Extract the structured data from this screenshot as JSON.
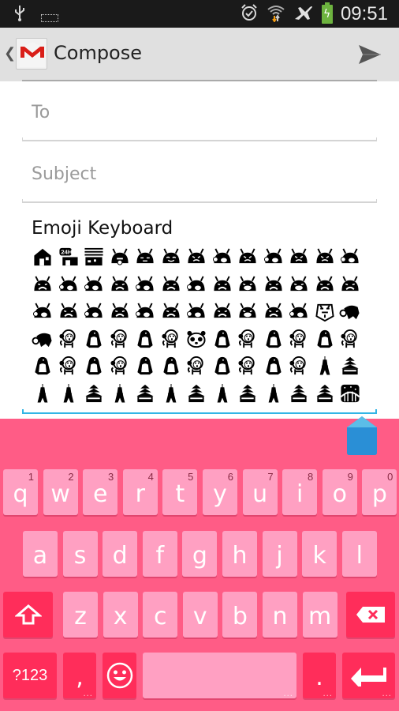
{
  "status_bar": {
    "left_icons": [
      "usb-icon",
      "keyboard-icon"
    ],
    "right_icons": [
      "alarm-icon",
      "wifi-icon",
      "airplane-icon",
      "battery-charging-icon"
    ],
    "time": "09:51",
    "battery_color": "#6db33f"
  },
  "action_bar": {
    "back_icon": "chevron-left-icon",
    "app_icon": "gmail-icon",
    "title": "Compose",
    "send_icon": "send-icon"
  },
  "compose": {
    "to_placeholder": "To",
    "to_value": "",
    "subject_placeholder": "Subject",
    "subject_value": "",
    "body_text": "Emoji Keyboard",
    "focus_color": "#33b5e5",
    "emoji_rows": [
      [
        "house",
        "convenience-store-24h",
        "office-building",
        "droid-tongue",
        "droid-sleepy",
        "droid-content",
        "droid-angry",
        "droid-sweat",
        "droid-angry",
        "droid-sweat",
        "droid-angry",
        "droid-angry",
        "droid-sweat"
      ],
      [
        "droid-sad",
        "droid-sweat",
        "droid-sweat",
        "droid-sad",
        "droid-sweat",
        "droid-sad",
        "droid-sweat",
        "droid-sad",
        "droid-crying",
        "droid-sad",
        "droid-crying",
        "droid-sad",
        "droid-sad"
      ],
      [
        "droid-sweat",
        "droid-sad",
        "droid-sweat",
        "droid-sad",
        "droid-sweat",
        "droid-sad",
        "droid-sweat",
        "droid-sad",
        "droid-crying",
        "droid-sad",
        "droid-sweat",
        "tiger-face",
        "boar"
      ],
      [
        "boar",
        "monkey",
        "penguin",
        "monkey",
        "penguin",
        "monkey",
        "panda-face",
        "penguin",
        "monkey",
        "penguin",
        "monkey",
        "penguin",
        "monkey"
      ],
      [
        "penguin",
        "monkey",
        "penguin",
        "monkey",
        "penguin",
        "penguin",
        "monkey",
        "penguin",
        "monkey",
        "penguin",
        "monkey",
        "tokyo-tower",
        "castle"
      ],
      [
        "tokyo-tower",
        "tokyo-tower",
        "castle",
        "tokyo-tower",
        "castle",
        "tokyo-tower",
        "castle",
        "tokyo-tower",
        "castle",
        "tokyo-tower",
        "castle",
        "castle",
        "night-bridge"
      ]
    ]
  },
  "keyboard": {
    "colors": {
      "background": "#ff5c86",
      "key": "#ffa0c2",
      "function_key": "#ff2d5a",
      "hint": "#8a2a44"
    },
    "row1": [
      {
        "label": "q",
        "hint": "1"
      },
      {
        "label": "w",
        "hint": "2"
      },
      {
        "label": "e",
        "hint": "3"
      },
      {
        "label": "r",
        "hint": "4"
      },
      {
        "label": "t",
        "hint": "5"
      },
      {
        "label": "y",
        "hint": "6"
      },
      {
        "label": "u",
        "hint": "7"
      },
      {
        "label": "i",
        "hint": "8"
      },
      {
        "label": "o",
        "hint": "9"
      },
      {
        "label": "p",
        "hint": "0"
      }
    ],
    "row2": [
      {
        "label": "a"
      },
      {
        "label": "s"
      },
      {
        "label": "d"
      },
      {
        "label": "f"
      },
      {
        "label": "g"
      },
      {
        "label": "h"
      },
      {
        "label": "j"
      },
      {
        "label": "k"
      },
      {
        "label": "l"
      }
    ],
    "row3": [
      {
        "label": "z"
      },
      {
        "label": "x"
      },
      {
        "label": "c"
      },
      {
        "label": "v"
      },
      {
        "label": "b"
      },
      {
        "label": "n"
      },
      {
        "label": "m"
      }
    ],
    "shift_icon": "shift-icon",
    "backspace_icon": "backspace-icon",
    "symbols_label": "?123",
    "comma_label": ",",
    "emoji_key_icon": "smiley-icon",
    "space_label": "",
    "period_label": ".",
    "enter_icon": "enter-icon",
    "more_dots": "..."
  }
}
